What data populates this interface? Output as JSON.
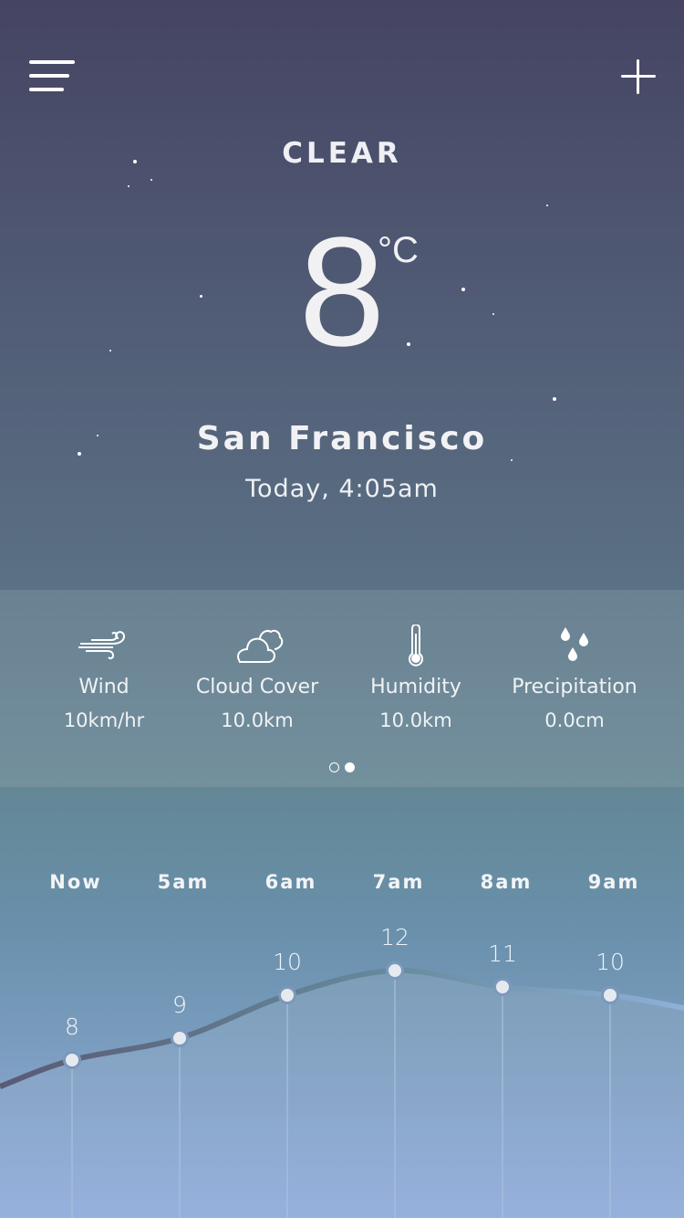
{
  "header": {
    "menu_icon": "hamburger-menu-icon",
    "add_icon": "plus-icon"
  },
  "current": {
    "condition": "CLEAR",
    "temperature": "8",
    "unit": "°C",
    "city": "San Francisco",
    "datetime": "Today, 4:05am"
  },
  "stats": [
    {
      "icon": "wind-icon",
      "label": "Wind",
      "value": "10km/hr"
    },
    {
      "icon": "cloud-icon",
      "label": "Cloud Cover",
      "value": "10.0km"
    },
    {
      "icon": "thermometer-icon",
      "label": "Humidity",
      "value": "10.0km"
    },
    {
      "icon": "raindrops-icon",
      "label": "Precipitation",
      "value": "0.0cm"
    }
  ],
  "pager": {
    "pages": 2,
    "active": 2
  },
  "colors": {
    "top": "#454463",
    "bottom": "#95b0dc",
    "line_start": "#5a5a75",
    "line_end": "#8fb0d8"
  },
  "chart_data": {
    "type": "line",
    "categories": [
      "Now",
      "5am",
      "6am",
      "7am",
      "8am",
      "9am"
    ],
    "values": [
      8,
      9,
      10,
      12,
      11,
      10
    ],
    "labels": [
      "8",
      "9",
      "10",
      "12",
      "11",
      "10"
    ]
  }
}
